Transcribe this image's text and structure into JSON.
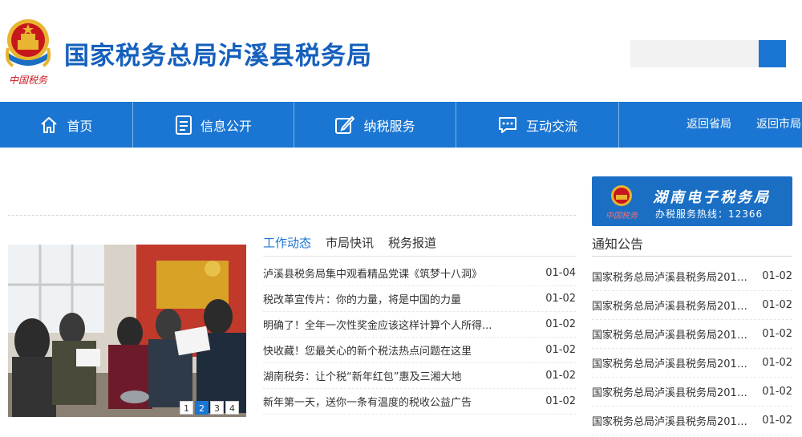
{
  "header": {
    "site_title": "国家税务总局泸溪县税务局",
    "emblem_caption": "中国税务",
    "search": {
      "placeholder": ""
    }
  },
  "nav": {
    "items": [
      {
        "label": "首页",
        "icon": "home-icon"
      },
      {
        "label": "信息公开",
        "icon": "document-icon"
      },
      {
        "label": "纳税服务",
        "icon": "edit-icon"
      },
      {
        "label": "互动交流",
        "icon": "chat-icon"
      }
    ],
    "links": [
      "返回省局",
      "返回市局"
    ]
  },
  "slider": {
    "pages": [
      "1",
      "2",
      "3",
      "4"
    ],
    "active_index": 1
  },
  "news": {
    "tabs": [
      "工作动态",
      "市局快讯",
      "税务报道"
    ],
    "active_tab": 0,
    "items": [
      {
        "title": "泸溪县税务局集中观看精品党课《筑梦十八洞》",
        "date": "01-04"
      },
      {
        "title": "税改革宣传片：你的力量，将是中国的力量",
        "date": "01-02"
      },
      {
        "title": "明确了！全年一次性奖金应该这样计算个人所得...",
        "date": "01-02"
      },
      {
        "title": "快收藏！您最关心的新个税法热点问题在这里",
        "date": "01-02"
      },
      {
        "title": "湖南税务：让个税“新年红包”惠及三湘大地",
        "date": "01-02"
      },
      {
        "title": "新年第一天，送你一条有温度的税收公益广告",
        "date": "01-02"
      }
    ]
  },
  "banner": {
    "title": "湖南电子税务局",
    "subtitle": "办税服务热线：12366",
    "logo_caption": "中国税务"
  },
  "notices": {
    "heading": "通知公告",
    "items": [
      {
        "title": "国家税务总局泸溪县税务局2018...",
        "date": "01-02"
      },
      {
        "title": "国家税务总局泸溪县税务局2018...",
        "date": "01-02"
      },
      {
        "title": "国家税务总局泸溪县税务局2018...",
        "date": "01-02"
      },
      {
        "title": "国家税务总局泸溪县税务局2018...",
        "date": "01-02"
      },
      {
        "title": "国家税务总局泸溪县税务局2018...",
        "date": "01-02"
      },
      {
        "title": "国家税务总局泸溪县税务局2018...",
        "date": "01-02"
      }
    ]
  },
  "colors": {
    "brand_blue": "#1a76d2",
    "title_blue": "#1560bd",
    "emblem_red": "#c8161d",
    "emblem_gold": "#e8b530"
  }
}
